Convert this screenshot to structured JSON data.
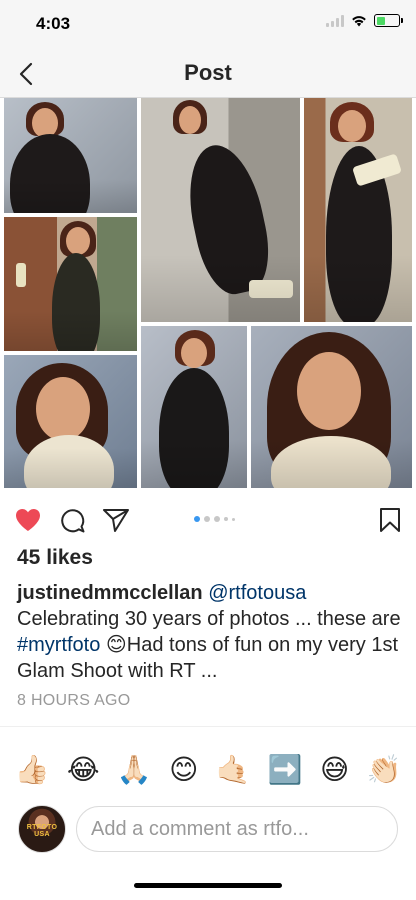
{
  "status_bar": {
    "time": "4:03",
    "battery_level": 0.4
  },
  "nav": {
    "title": "Post"
  },
  "post": {
    "likes": "45 likes",
    "username": "justinedmmcclellan",
    "mention": "@rtfotousa",
    "caption_part1": "Celebrating 30 years of photos ... these are ",
    "hashtag": "#myrtfoto",
    "caption_part2": " 😊Had tons of fun on my very 1st Glam Shoot with RT ...",
    "timestamp": "8 HOURS AGO",
    "carousel": {
      "count": 5,
      "active": 1
    }
  },
  "quick_reactions": [
    "👍🏻",
    "😂",
    "🙏🏻",
    "😊",
    "🤙🏻",
    "➡️",
    "😅",
    "👏🏻"
  ],
  "comment": {
    "avatar_text": "RTFOTO USA",
    "placeholder": "Add a comment as rtfo..."
  },
  "colors": {
    "like": "#ed4956",
    "link": "#003569",
    "carousel_active": "#3897f0"
  }
}
